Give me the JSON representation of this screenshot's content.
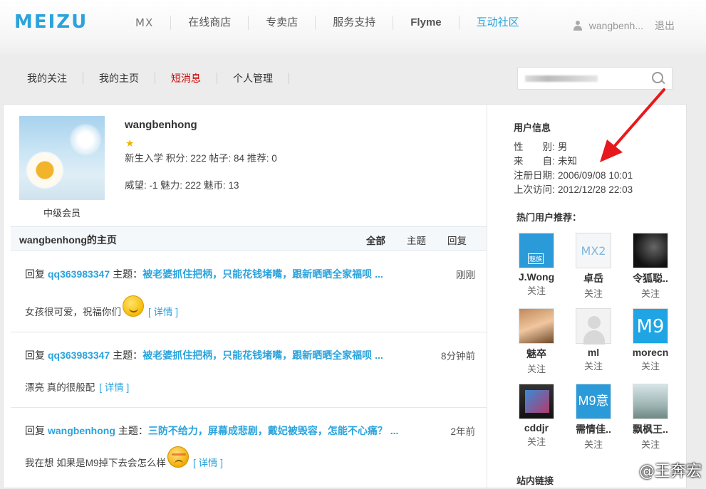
{
  "header": {
    "logo": "MEIZU",
    "nav": [
      "MX",
      "在线商店",
      "专卖店",
      "服务支持",
      "Flyme",
      "互动社区"
    ],
    "nav_active": "互动社区",
    "username": "wangbenh...",
    "logout": "退出"
  },
  "subnav": {
    "items": [
      "我的关注",
      "我的主页",
      "短消息",
      "个人管理"
    ],
    "active": "短消息"
  },
  "profile": {
    "name": "wangbenhong",
    "level": "中级会员",
    "stats_line1": "新生入学 积分: 222 帖子: 84 推荐: 0",
    "stats_line2": "威望: -1 魅力: 222 魅币: 13"
  },
  "homepage": {
    "title": "wangbenhong的主页",
    "tabs": [
      "全部",
      "主题",
      "回复"
    ]
  },
  "feed": [
    {
      "action": "回复",
      "user": "qq363983347",
      "topic_label": "主题：",
      "topic": "被老婆抓住把柄，只能花钱堵嘴，跟新晒晒全家福呗 ...",
      "time": "刚刚",
      "body": "女孩很可爱，祝福你们",
      "emoji": "smile",
      "detail": "[ 详情 ]"
    },
    {
      "action": "回复",
      "user": "qq363983347",
      "topic_label": "主题：",
      "topic": "被老婆抓住把柄，只能花钱堵嘴，跟新晒晒全家福呗 ...",
      "time": "8分钟前",
      "body": "漂亮 真的很般配",
      "emoji": "",
      "detail": "[ 详情 ]"
    },
    {
      "action": "回复",
      "user": "wangbenhong",
      "topic_label": "主题：",
      "topic": "三防不给力，屏幕成悲剧，戴妃被毁容，怎能不心痛？ ...",
      "time": "2年前",
      "body": "我在想 如果是M9掉下去会怎么样",
      "emoji": "sad",
      "detail": "[ 详情 ]"
    }
  ],
  "user_info": {
    "title": "用户信息",
    "rows": [
      {
        "k": "性　　别:",
        "v": "男"
      },
      {
        "k": "来　　自:",
        "v": "未知"
      },
      {
        "k": "注册日期:",
        "v": "2006/09/08 10:01"
      },
      {
        "k": "上次访问:",
        "v": "2012/12/28 22:03"
      }
    ]
  },
  "hot_users": {
    "title": "热门用户推荐：",
    "users": [
      {
        "name": "J.Wong",
        "follow": "关注"
      },
      {
        "name": "卓岳",
        "follow": "关注",
        "thumb_text": "MX2"
      },
      {
        "name": "令狐聪..",
        "follow": "关注"
      },
      {
        "name": "魅卒",
        "follow": "关注"
      },
      {
        "name": "ml",
        "follow": "关注"
      },
      {
        "name": "morecn",
        "follow": "关注",
        "thumb_text": "M9"
      },
      {
        "name": "cddjr",
        "follow": "关注"
      },
      {
        "name": "需情佳..",
        "follow": "关注",
        "thumb_text": "M9意"
      },
      {
        "name": "飘枫王..",
        "follow": "关注"
      }
    ]
  },
  "links_title": "站内链接",
  "watermark": "@王奔宏",
  "colors": {
    "accent": "#2ba3dc",
    "active_red": "#cc0000",
    "arrow": "#e8191c"
  }
}
